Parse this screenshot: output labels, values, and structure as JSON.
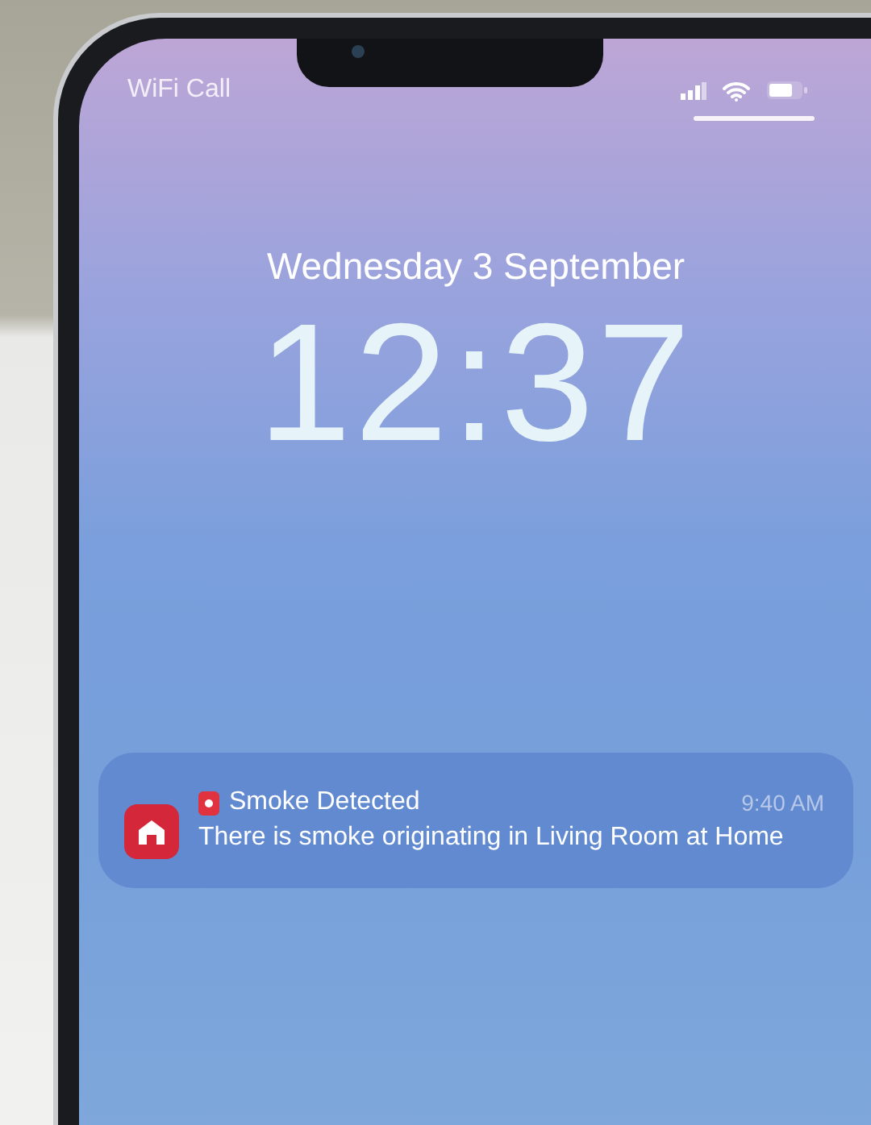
{
  "status_bar": {
    "carrier": "WiFi Call"
  },
  "lock_screen": {
    "date": "Wednesday 3 September",
    "time": "12:37"
  },
  "notification": {
    "title": "Smoke Detected",
    "time": "9:40 AM",
    "message": "There is smoke originating in Living Room at Home"
  }
}
